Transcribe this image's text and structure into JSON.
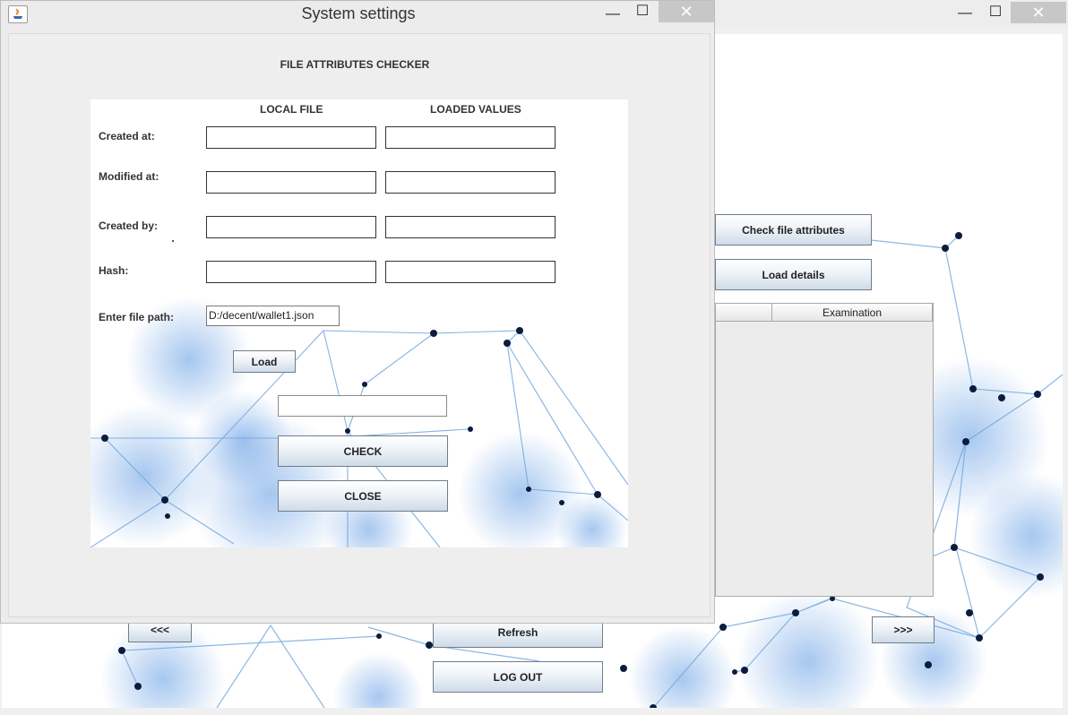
{
  "main_window": {
    "controls": {
      "minimize": "—",
      "maximize": "☐",
      "close": "✕"
    },
    "buttons": {
      "check_file_attributes": "Check file attributes",
      "load_details": "Load details",
      "prev": "<<<",
      "next": ">>>",
      "refresh": "Refresh",
      "log_out": "LOG OUT"
    },
    "table": {
      "columns": [
        "",
        "Examination"
      ]
    }
  },
  "dialog": {
    "title": "System settings",
    "controls": {
      "minimize": "—",
      "maximize": "☐",
      "close": "✕"
    },
    "heading": "FILE ATTRIBUTES CHECKER",
    "col_local": "LOCAL FILE",
    "col_loaded": "LOADED VALUES",
    "rows": [
      {
        "label": "Created at:",
        "local": "",
        "loaded": ""
      },
      {
        "label": "Modified at:",
        "local": "",
        "loaded": ""
      },
      {
        "label": "Created by:",
        "local": "",
        "loaded": ""
      },
      {
        "label": "Hash:",
        "local": "",
        "loaded": ""
      }
    ],
    "path_label": "Enter file path:",
    "path_value": "D:/decent/wallet1.json",
    "load_button": "Load",
    "result_value": "",
    "check_button": "CHECK",
    "close_button": "CLOSE"
  },
  "colors": {
    "network_blue": "#1a5fb4",
    "node_dark": "#0b1c3d",
    "close_bg": "#c7c7c7"
  }
}
